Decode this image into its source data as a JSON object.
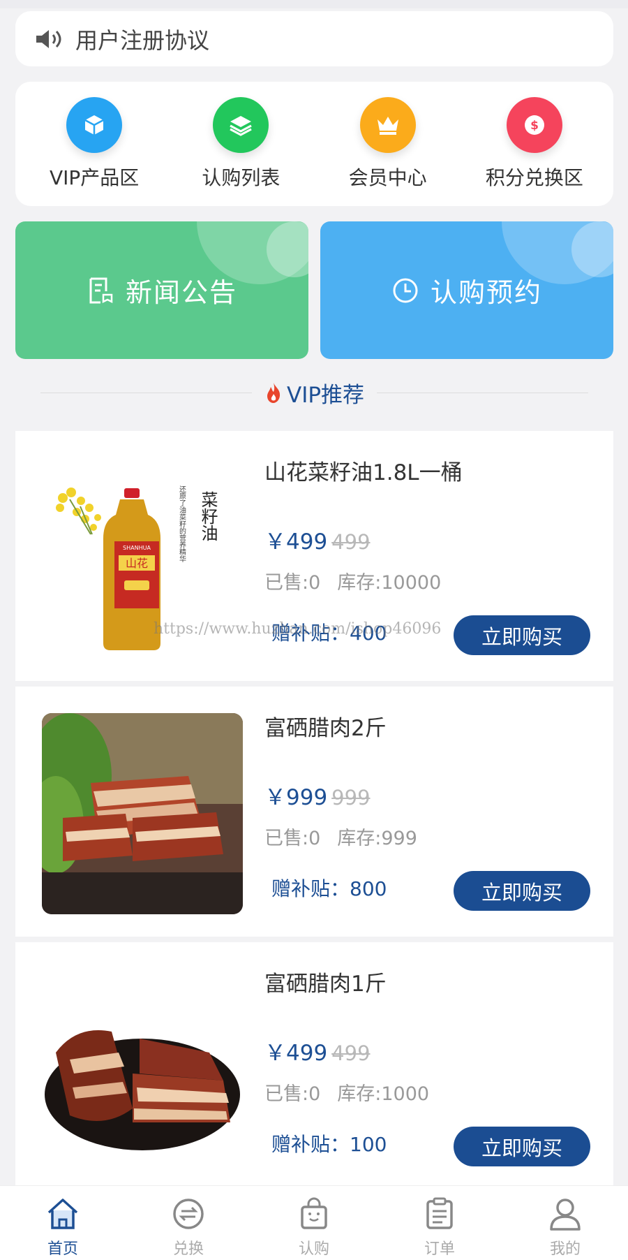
{
  "notice": {
    "text": "用户注册协议",
    "icon": "speaker-icon"
  },
  "quick_nav": [
    {
      "label": "VIP产品区",
      "icon": "box-icon",
      "color": "#27a4f2"
    },
    {
      "label": "认购列表",
      "icon": "layers-icon",
      "color": "#22c75c"
    },
    {
      "label": "会员中心",
      "icon": "crown-icon",
      "color": "#fbab1b"
    },
    {
      "label": "积分兑换区",
      "icon": "dollar-icon",
      "color": "#f5445c"
    }
  ],
  "banners": [
    {
      "label": "新闻公告",
      "icon": "document-icon",
      "color": "#5bc98d"
    },
    {
      "label": "认购预约",
      "icon": "clock-icon",
      "color": "#4db0f2"
    }
  ],
  "section": {
    "title": "VIP推荐",
    "icon": "flame-icon"
  },
  "products": [
    {
      "name": "山花菜籽油1.8L一桶",
      "price": "￥499",
      "old_price": "499",
      "sold": "已售:0",
      "stock": "库存:10000",
      "subsidy": "赠补贴：400",
      "buy_label": "立即购买"
    },
    {
      "name": "富硒腊肉2斤",
      "price": "￥999",
      "old_price": "999",
      "sold": "已售:0",
      "stock": "库存:999",
      "subsidy": "赠补贴：800",
      "buy_label": "立即购买"
    },
    {
      "name": "富硒腊肉1斤",
      "price": "￥499",
      "old_price": "499",
      "sold": "已售:0",
      "stock": "库存:1000",
      "subsidy": "赠补贴：100",
      "buy_label": "立即购买"
    }
  ],
  "product_image_text": {
    "brand": "SHANHUA",
    "logo": "山花",
    "tag": "菜籽油",
    "side": "还原了油菜籽的营养精华"
  },
  "watermark": "https://www.huzhan.com/ishop46096",
  "tabs": [
    {
      "label": "首页",
      "icon": "home-icon",
      "active": true
    },
    {
      "label": "兑换",
      "icon": "exchange-icon",
      "active": false
    },
    {
      "label": "认购",
      "icon": "shopping-bag-icon",
      "active": false
    },
    {
      "label": "订单",
      "icon": "clipboard-icon",
      "active": false
    },
    {
      "label": "我的",
      "icon": "user-icon",
      "active": false
    }
  ]
}
